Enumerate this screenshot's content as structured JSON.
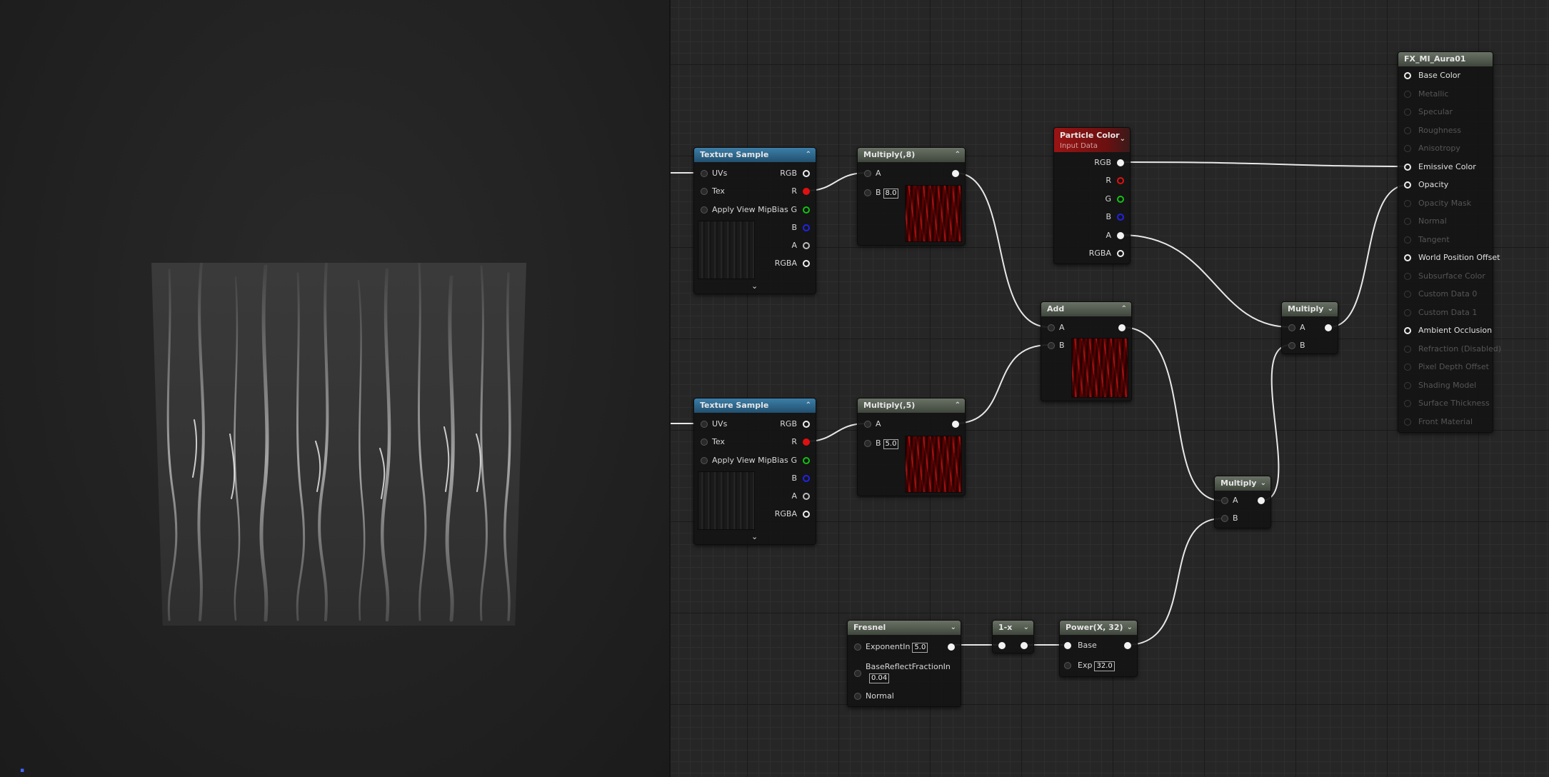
{
  "viewport": {
    "gizmo": "▪"
  },
  "nodes": {
    "tex1": {
      "title": "Texture Sample",
      "inputs": [
        "UVs",
        "Tex",
        "Apply View MipBias"
      ],
      "outputs": [
        "RGB",
        "R",
        "G",
        "B",
        "A",
        "RGBA"
      ]
    },
    "tex2": {
      "title": "Texture Sample",
      "inputs": [
        "UVs",
        "Tex",
        "Apply View MipBias"
      ],
      "outputs": [
        "RGB",
        "R",
        "G",
        "B",
        "A",
        "RGBA"
      ]
    },
    "mul8": {
      "title": "Multiply(,8)",
      "a": "A",
      "b": "B",
      "b_value": "8.0"
    },
    "mul5": {
      "title": "Multiply(,5)",
      "a": "A",
      "b": "B",
      "b_value": "5.0"
    },
    "particle": {
      "title": "Particle Color",
      "subtitle": "Input Data",
      "outputs": [
        "RGB",
        "R",
        "G",
        "B",
        "A",
        "RGBA"
      ]
    },
    "add": {
      "title": "Add",
      "a": "A",
      "b": "B"
    },
    "multiply_top": {
      "title": "Multiply",
      "a": "A",
      "b": "B"
    },
    "multiply_bottom": {
      "title": "Multiply",
      "a": "A",
      "b": "B"
    },
    "fresnel": {
      "title": "Fresnel",
      "exponent_label": "ExponentIn",
      "exponent_value": "5.0",
      "base_reflect_label": "BaseReflectFractionIn",
      "base_reflect_value": "0.04",
      "normal_label": "Normal"
    },
    "one_minus": {
      "title": "1-x"
    },
    "power": {
      "title": "Power(X, 32)",
      "base": "Base",
      "exp": "Exp",
      "exp_value": "32.0"
    },
    "material": {
      "title": "FX_MI_Aura01",
      "inputs": [
        {
          "label": "Base Color",
          "active": true
        },
        {
          "label": "Metallic",
          "active": false
        },
        {
          "label": "Specular",
          "active": false
        },
        {
          "label": "Roughness",
          "active": false
        },
        {
          "label": "Anisotropy",
          "active": false
        },
        {
          "label": "Emissive Color",
          "active": true
        },
        {
          "label": "Opacity",
          "active": true
        },
        {
          "label": "Opacity Mask",
          "active": false
        },
        {
          "label": "Normal",
          "active": false
        },
        {
          "label": "Tangent",
          "active": false
        },
        {
          "label": "World Position Offset",
          "active": true
        },
        {
          "label": "Subsurface Color",
          "active": false
        },
        {
          "label": "Custom Data 0",
          "active": false
        },
        {
          "label": "Custom Data 1",
          "active": false
        },
        {
          "label": "Ambient Occlusion",
          "active": true
        },
        {
          "label": "Refraction (Disabled)",
          "active": false
        },
        {
          "label": "Pixel Depth Offset",
          "active": false
        },
        {
          "label": "Shading Model",
          "active": false
        },
        {
          "label": "Surface Thickness",
          "active": false
        },
        {
          "label": "Front Material",
          "active": false
        }
      ]
    }
  },
  "colors": {
    "wire": "#e8e8e8",
    "header_blue": "#2d6a92",
    "header_red": "#8a1212",
    "pin_red": "#e01010",
    "pin_green": "#12c212",
    "pin_blue": "#2222e8"
  }
}
